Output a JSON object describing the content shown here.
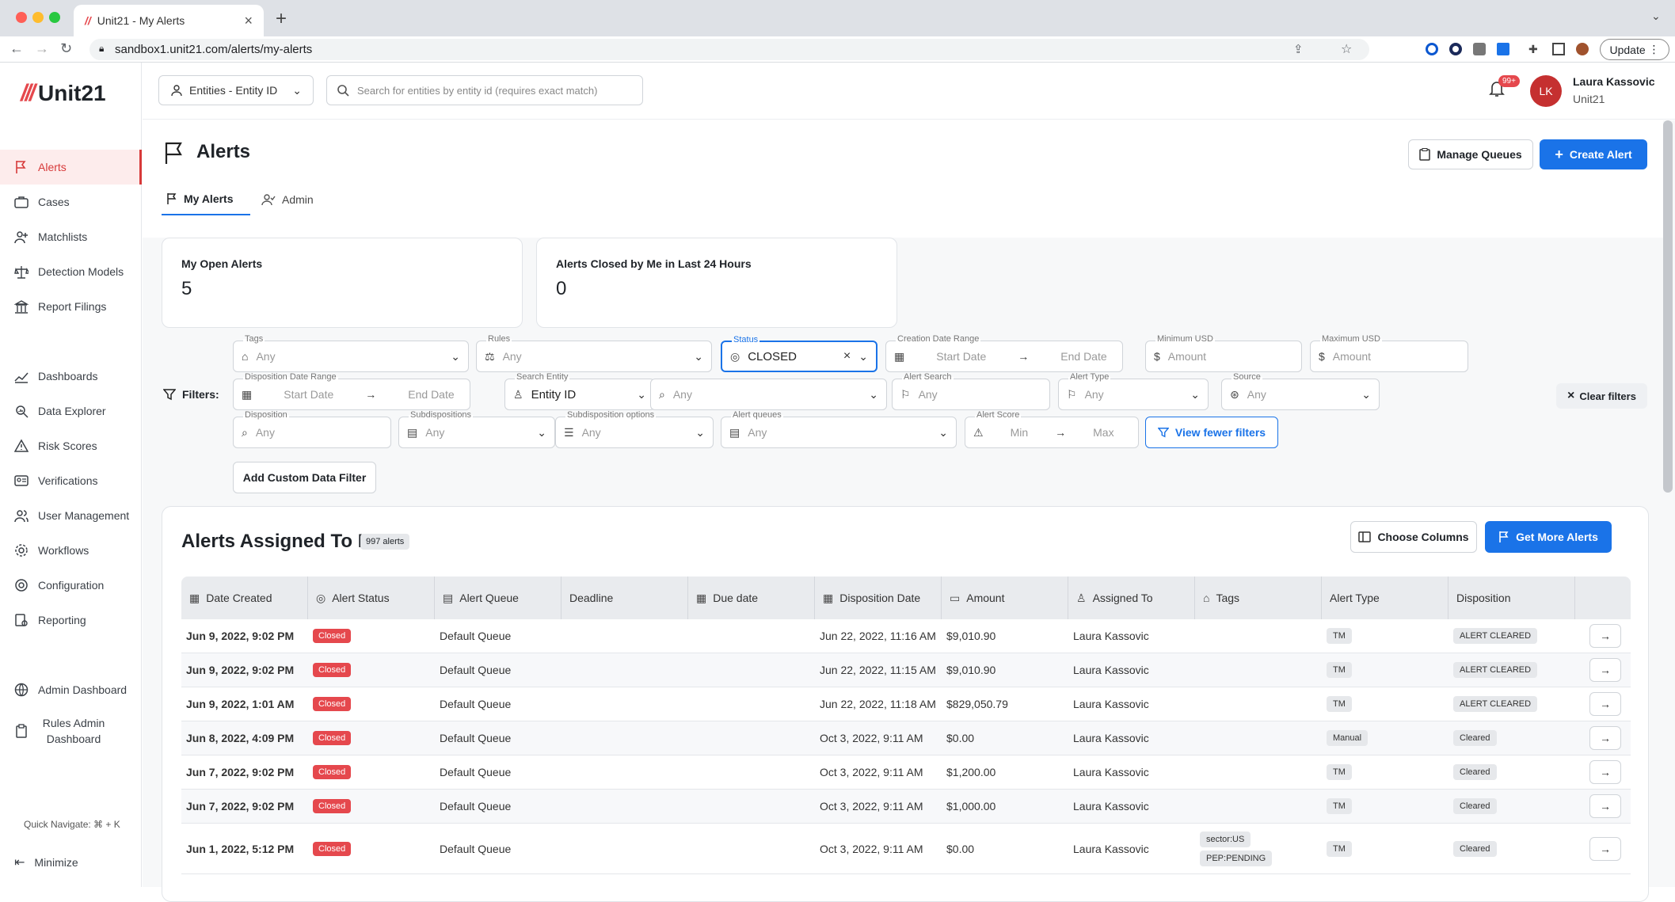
{
  "browser": {
    "tab_title": "Unit21 - My Alerts",
    "url": "sandbox1.unit21.com/alerts/my-alerts",
    "update_label": "Update"
  },
  "app": {
    "logo_text": "Unit21",
    "entity_selector": "Entities - Entity ID",
    "entity_search_placeholder": "Search for entities by entity id (requires exact match)",
    "notifications_badge": "99+",
    "user_initials": "LK",
    "user_name": "Laura Kassovic",
    "user_org": "Unit21"
  },
  "sidebar": {
    "items": [
      {
        "label": "Alerts",
        "icon": "flag-icon"
      },
      {
        "label": "Cases",
        "icon": "briefcase-icon"
      },
      {
        "label": "Matchlists",
        "icon": "user-plus-icon"
      },
      {
        "label": "Detection Models",
        "icon": "scale-icon"
      },
      {
        "label": "Report Filings",
        "icon": "building-icon"
      },
      {
        "label": "Dashboards",
        "icon": "chart-line-icon"
      },
      {
        "label": "Data Explorer",
        "icon": "search-data-icon"
      },
      {
        "label": "Risk Scores",
        "icon": "warning-icon"
      },
      {
        "label": "Verifications",
        "icon": "id-card-icon"
      },
      {
        "label": "User Management",
        "icon": "users-icon"
      },
      {
        "label": "Workflows",
        "icon": "settings-cog-icon"
      },
      {
        "label": "Configuration",
        "icon": "gear-icon"
      },
      {
        "label": "Reporting",
        "icon": "report-icon"
      },
      {
        "label": "Admin Dashboard",
        "icon": "globe-icon"
      },
      {
        "label": "Rules Admin Dashboard",
        "icon": "clipboard-icon"
      }
    ],
    "quick_navigate": "Quick Navigate: ⌘ + K",
    "minimize": "Minimize"
  },
  "page": {
    "title": "Alerts",
    "manage_queues": "Manage Queues",
    "create_alert": "Create Alert",
    "tabs": [
      "My Alerts",
      "Admin"
    ]
  },
  "stats": [
    {
      "label": "My Open Alerts",
      "value": "5"
    },
    {
      "label": "Alerts Closed by Me in Last 24 Hours",
      "value": "0"
    }
  ],
  "filters": {
    "label": "Filters:",
    "tags": {
      "label": "Tags",
      "value": "Any"
    },
    "rules": {
      "label": "Rules",
      "value": "Any"
    },
    "status": {
      "label": "Status",
      "value": "CLOSED"
    },
    "creation_range": {
      "label": "Creation Date Range",
      "start": "Start Date",
      "end": "End Date"
    },
    "min_usd": {
      "label": "Minimum USD",
      "value": "Amount"
    },
    "max_usd": {
      "label": "Maximum USD",
      "value": "Amount"
    },
    "disposition_range": {
      "label": "Disposition Date Range",
      "start": "Start Date",
      "end": "End Date"
    },
    "search_entity": {
      "label": "Search Entity",
      "value": "Entity ID"
    },
    "entity_any": "Any",
    "alert_search": {
      "label": "Alert Search",
      "value": "Any"
    },
    "alert_type": {
      "label": "Alert Type",
      "value": "Any"
    },
    "source": {
      "label": "Source",
      "value": "Any"
    },
    "disposition": {
      "label": "Disposition",
      "value": "Any"
    },
    "subdispositions": {
      "label": "Subdispositions",
      "value": "Any"
    },
    "subdisposition_options": {
      "label": "Subdisposition options",
      "value": "Any"
    },
    "alert_queues": {
      "label": "Alert queues",
      "value": "Any"
    },
    "alert_score": {
      "label": "Alert Score",
      "min": "Min",
      "max": "Max"
    },
    "view_fewer": "View fewer filters",
    "clear": "Clear filters",
    "add_custom": "Add Custom Data Filter"
  },
  "table": {
    "title": "Alerts Assigned To Me",
    "count": "997 alerts",
    "choose_columns": "Choose Columns",
    "get_more": "Get More Alerts",
    "columns": [
      "Date Created",
      "Alert Status",
      "Alert Queue",
      "Deadline",
      "Due date",
      "Disposition Date",
      "Amount",
      "Assigned To",
      "Tags",
      "Alert Type",
      "Disposition"
    ],
    "rows": [
      {
        "date": "Jun 9, 2022, 9:02 PM",
        "status": "Closed",
        "queue": "Default Queue",
        "deadline": "",
        "due": "",
        "disp_date": "Jun 22, 2022, 11:16 AM",
        "amount": "$9,010.90",
        "assigned": "Laura Kassovic",
        "tags": [],
        "type": "TM",
        "disposition": "ALERT CLEARED"
      },
      {
        "date": "Jun 9, 2022, 9:02 PM",
        "status": "Closed",
        "queue": "Default Queue",
        "deadline": "",
        "due": "",
        "disp_date": "Jun 22, 2022, 11:15 AM",
        "amount": "$9,010.90",
        "assigned": "Laura Kassovic",
        "tags": [],
        "type": "TM",
        "disposition": "ALERT CLEARED"
      },
      {
        "date": "Jun 9, 2022, 1:01 AM",
        "status": "Closed",
        "queue": "Default Queue",
        "deadline": "",
        "due": "",
        "disp_date": "Jun 22, 2022, 11:18 AM",
        "amount": "$829,050.79",
        "assigned": "Laura Kassovic",
        "tags": [],
        "type": "TM",
        "disposition": "ALERT CLEARED"
      },
      {
        "date": "Jun 8, 2022, 4:09 PM",
        "status": "Closed",
        "queue": "Default Queue",
        "deadline": "",
        "due": "",
        "disp_date": "Oct 3, 2022, 9:11 AM",
        "amount": "$0.00",
        "assigned": "Laura Kassovic",
        "tags": [],
        "type": "Manual",
        "disposition": "Cleared"
      },
      {
        "date": "Jun 7, 2022, 9:02 PM",
        "status": "Closed",
        "queue": "Default Queue",
        "deadline": "",
        "due": "",
        "disp_date": "Oct 3, 2022, 9:11 AM",
        "amount": "$1,200.00",
        "assigned": "Laura Kassovic",
        "tags": [],
        "type": "TM",
        "disposition": "Cleared"
      },
      {
        "date": "Jun 7, 2022, 9:02 PM",
        "status": "Closed",
        "queue": "Default Queue",
        "deadline": "",
        "due": "",
        "disp_date": "Oct 3, 2022, 9:11 AM",
        "amount": "$1,000.00",
        "assigned": "Laura Kassovic",
        "tags": [],
        "type": "TM",
        "disposition": "Cleared"
      },
      {
        "date": "Jun 1, 2022, 5:12 PM",
        "status": "Closed",
        "queue": "Default Queue",
        "deadline": "",
        "due": "",
        "disp_date": "Oct 3, 2022, 9:11 AM",
        "amount": "$0.00",
        "assigned": "Laura Kassovic",
        "tags": [
          "sector:US",
          "PEP:PENDING"
        ],
        "type": "TM",
        "disposition": "Cleared"
      }
    ]
  }
}
